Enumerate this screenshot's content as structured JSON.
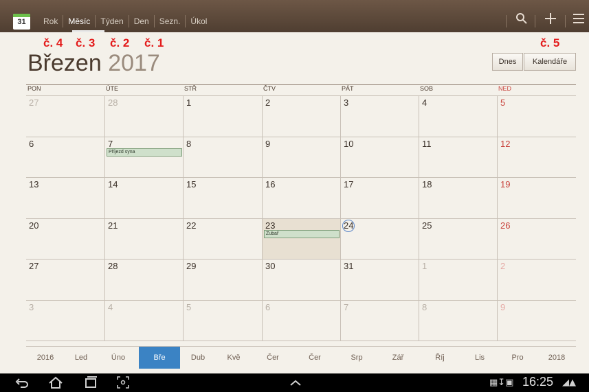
{
  "app": {
    "icon_number": "31"
  },
  "tabs": [
    {
      "label": "Rok"
    },
    {
      "label": "Měsíc",
      "active": true
    },
    {
      "label": "Týden"
    },
    {
      "label": "Den"
    },
    {
      "label": "Sezn."
    },
    {
      "label": "Úkol"
    }
  ],
  "annotations": [
    "č. 4",
    "č. 3",
    "č. 2",
    "č. 1",
    "č. 5"
  ],
  "header": {
    "month": "Březen",
    "year": "2017",
    "today_button": "Dnes",
    "calendars_button": "Kalendáře"
  },
  "weekdays": [
    "PON",
    "ÚTE",
    "STŘ",
    "ČTV",
    "PÁT",
    "SOB",
    "NED"
  ],
  "weeks": [
    [
      "27",
      "28",
      "1",
      "2",
      "3",
      "4",
      "5"
    ],
    [
      "6",
      "7",
      "8",
      "9",
      "10",
      "11",
      "12"
    ],
    [
      "13",
      "14",
      "15",
      "16",
      "17",
      "18",
      "19"
    ],
    [
      "20",
      "21",
      "22",
      "23",
      "24",
      "25",
      "26"
    ],
    [
      "27",
      "28",
      "29",
      "30",
      "31",
      "1",
      "2"
    ],
    [
      "3",
      "4",
      "5",
      "6",
      "7",
      "8",
      "9"
    ]
  ],
  "events": [
    {
      "week": 1,
      "day": 1,
      "label": "Příjezd syna"
    },
    {
      "week": 3,
      "day": 3,
      "label": "Zubař"
    }
  ],
  "month_strip": [
    "2016",
    "Led",
    "Úno",
    "Bře",
    "Dub",
    "Kvě",
    "Čer",
    "Čer",
    "Srp",
    "Zář",
    "Říj",
    "Lis",
    "Pro",
    "2018"
  ],
  "month_strip_selected": 3,
  "status_bar": {
    "time": "16:25"
  },
  "colors": {
    "accent": "#3b83c4",
    "sunday": "#c8433c",
    "today_circle": "#5b86c8",
    "event_fill": "#cfe0cb"
  }
}
